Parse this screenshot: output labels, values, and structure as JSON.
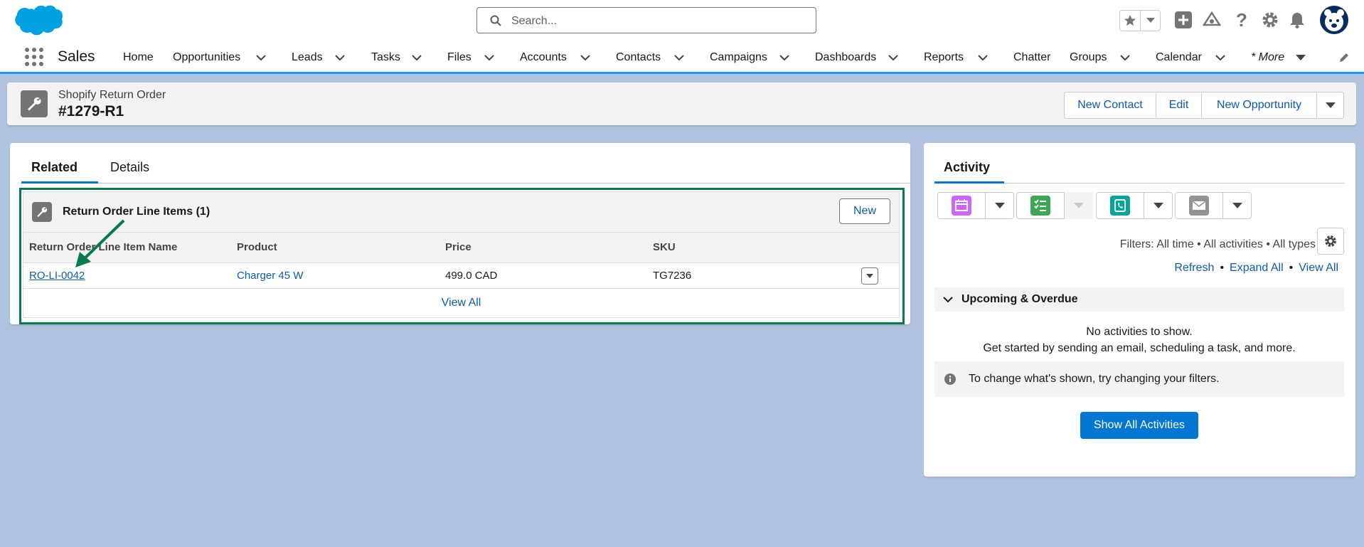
{
  "app": {
    "name": "Sales"
  },
  "search": {
    "placeholder": "Search..."
  },
  "nav": {
    "items": [
      {
        "label": "Home",
        "has_menu": false
      },
      {
        "label": "Opportunities",
        "has_menu": true
      },
      {
        "label": "Leads",
        "has_menu": true
      },
      {
        "label": "Tasks",
        "has_menu": true
      },
      {
        "label": "Files",
        "has_menu": true
      },
      {
        "label": "Accounts",
        "has_menu": true
      },
      {
        "label": "Contacts",
        "has_menu": true
      },
      {
        "label": "Campaigns",
        "has_menu": true
      },
      {
        "label": "Dashboards",
        "has_menu": true
      },
      {
        "label": "Reports",
        "has_menu": true
      },
      {
        "label": "Chatter",
        "has_menu": false
      },
      {
        "label": "Groups",
        "has_menu": true
      },
      {
        "label": "Calendar",
        "has_menu": true
      }
    ],
    "more_label": "* More"
  },
  "record": {
    "object_type": "Shopify Return Order",
    "name": "#1279-R1",
    "actions": [
      "New Contact",
      "Edit",
      "New Opportunity"
    ]
  },
  "tabs": {
    "related": "Related",
    "details": "Details"
  },
  "related_list": {
    "title": "Return Order Line Items (1)",
    "new_label": "New",
    "columns": [
      "Return Order Line Item Name",
      "Product",
      "Price",
      "SKU"
    ],
    "rows": [
      {
        "name": "RO-LI-0042",
        "product": "Charger 45 W",
        "price": "499.0 CAD",
        "sku": "TG7236"
      }
    ],
    "view_all": "View All"
  },
  "activity": {
    "title": "Activity",
    "filters": "Filters: All time • All activities • All types",
    "links": {
      "refresh": "Refresh",
      "expand_all": "Expand All",
      "view_all": "View All"
    },
    "upcoming_label": "Upcoming & Overdue",
    "no_activities": "No activities to show.",
    "get_started": "Get started by sending an email, scheduling a task, and more.",
    "info_text": "To change what's shown, try changing your filters.",
    "show_all": "Show All Activities"
  },
  "colors": {
    "brand_blue": "#0176d3",
    "link_blue": "#0b5cab",
    "highlight_green": "#0a7a4d",
    "event_purple": "#cb65ff",
    "task_green": "#3ba755",
    "call_teal": "#06a59a",
    "email_gray": "#939393"
  }
}
